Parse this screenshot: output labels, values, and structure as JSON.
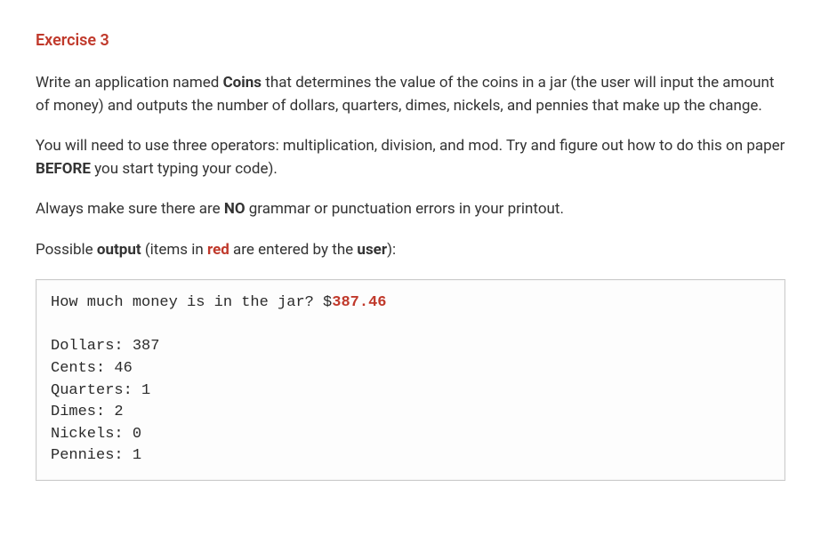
{
  "title": "Exercise 3",
  "para1": {
    "seg1": "Write an application named ",
    "bold1": "Coins",
    "seg2": " that determines the value of the coins in a jar (the user will input the amount of money) and outputs the number of dollars, quarters, dimes, nickels, and pennies that make up the change."
  },
  "para2": {
    "seg1": "You will need to use three operators: multiplication, division, and mod. Try and figure out how to do this on paper ",
    "bold1": "BEFORE",
    "seg2": " you start typing your code)."
  },
  "para3": {
    "seg1": "Always make sure there are ",
    "bold1": "NO",
    "seg2": " grammar or punctuation errors in your printout."
  },
  "para4": {
    "seg1": "Possible ",
    "bold1": "output",
    "seg2": " (items in ",
    "red1": "red",
    "seg3": " are entered by the ",
    "bold2": "user",
    "seg4": "):"
  },
  "output": {
    "prompt": "How much money is in the jar? $",
    "user_input": "387.46",
    "line_dollars": "Dollars: 387",
    "line_cents": "Cents: 46",
    "line_quarters": "Quarters: 1",
    "line_dimes": "Dimes: 2",
    "line_nickels": "Nickels: 0",
    "line_pennies": "Pennies: 1"
  }
}
